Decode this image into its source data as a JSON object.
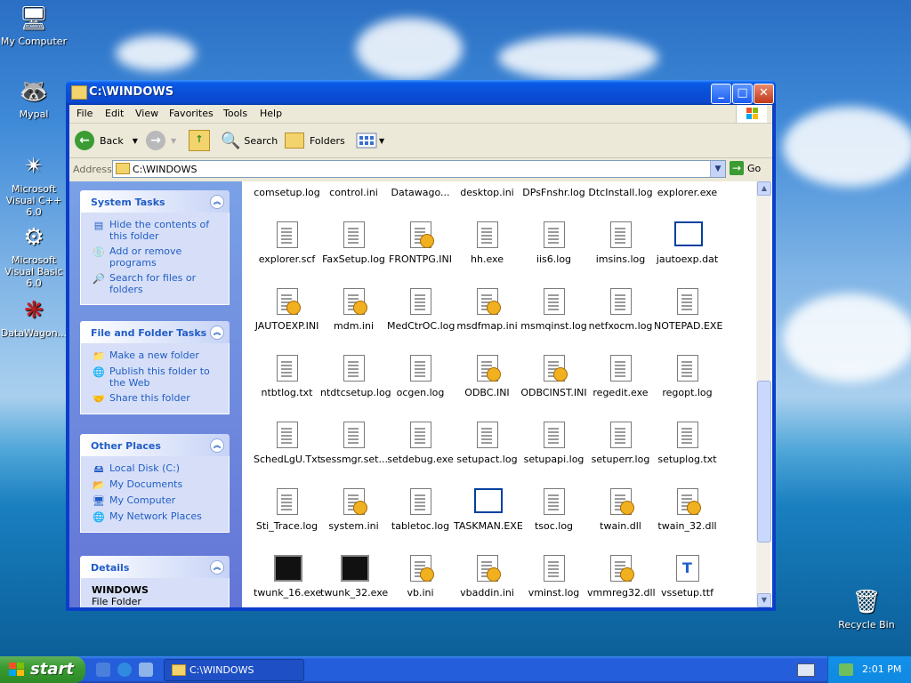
{
  "desktop": {
    "icons": [
      {
        "label": "My Computer",
        "icon": "computer-icon"
      },
      {
        "label": "Mypal",
        "icon": "raccoon-icon"
      },
      {
        "label": "Microsoft Visual C++ 6.0",
        "icon": "vc-icon"
      },
      {
        "label": "Microsoft Visual Basic 6.0",
        "icon": "vb-icon"
      },
      {
        "label": "DataWagon...",
        "icon": "datawagon-icon"
      },
      {
        "label": "Recycle Bin",
        "icon": "recycle-bin-icon"
      }
    ]
  },
  "window": {
    "title": "C:\\WINDOWS",
    "menu": [
      "File",
      "Edit",
      "View",
      "Favorites",
      "Tools",
      "Help"
    ],
    "toolbar": {
      "back": "Back",
      "search": "Search",
      "folders": "Folders"
    },
    "address": {
      "label": "Address",
      "value": "C:\\WINDOWS",
      "go": "Go"
    }
  },
  "taskpane": {
    "system_tasks": {
      "title": "System Tasks",
      "items": [
        "Hide the contents of this folder",
        "Add or remove programs",
        "Search for files or folders"
      ]
    },
    "file_folder_tasks": {
      "title": "File and Folder Tasks",
      "items": [
        "Make a new folder",
        "Publish this folder to the Web",
        "Share this folder"
      ]
    },
    "other_places": {
      "title": "Other Places",
      "items": [
        "Local Disk (C:)",
        "My Documents",
        "My Computer",
        "My Network Places"
      ]
    },
    "details": {
      "title": "Details",
      "name": "WINDOWS",
      "type": "File Folder"
    }
  },
  "files": [
    [
      "comsetup.log",
      "control.ini",
      "Datawago...",
      "desktop.ini",
      "DPsFnshr.log",
      "DtcInstall.log",
      "explorer.exe"
    ],
    [
      "explorer.scf",
      "FaxSetup.log",
      "FRONTPG.INI",
      "hh.exe",
      "iis6.log",
      "imsins.log",
      "jautoexp.dat"
    ],
    [
      "JAUTOEXP.INI",
      "mdm.ini",
      "MedCtrOC.log",
      "msdfmap.ini",
      "msmqinst.log",
      "netfxocm.log",
      "NOTEPAD.EXE"
    ],
    [
      "ntbtlog.txt",
      "ntdtcsetup.log",
      "ocgen.log",
      "ODBC.INI",
      "ODBCINST.INI",
      "regedit.exe",
      "regopt.log"
    ],
    [
      "SchedLgU.Txt",
      "sessmgr.set...",
      "setdebug.exe",
      "setupact.log",
      "setupapi.log",
      "setuperr.log",
      "setuplog.txt"
    ],
    [
      "Sti_Trace.log",
      "system.ini",
      "tabletoc.log",
      "TASKMAN.EXE",
      "tsoc.log",
      "twain.dll",
      "twain_32.dll"
    ],
    [
      "twunk_16.exe",
      "twunk_32.exe",
      "vb.ini",
      "vbaddin.ini",
      "vminst.log",
      "vmmreg32.dll",
      "vssetup.ttf"
    ]
  ],
  "taskbar": {
    "start": "start",
    "task": "C:\\WINDOWS",
    "clock": "2:01 PM"
  }
}
